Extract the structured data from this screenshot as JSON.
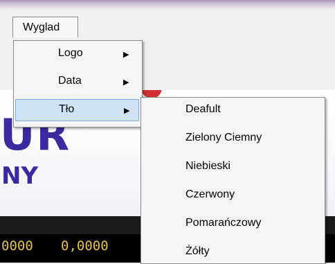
{
  "menubar": {
    "menu_label": "Wyglad"
  },
  "background_app": {
    "logo_text": "UR",
    "logo_sub": "NY",
    "display_values": [
      "0000",
      "0,0000"
    ]
  },
  "wyglad_menu": {
    "items": [
      {
        "label": "Logo",
        "has_submenu": true,
        "arrow_icon": "chevron-right-icon"
      },
      {
        "label": "Data",
        "has_submenu": true,
        "arrow_icon": "chevron-right-icon"
      },
      {
        "label": "Tło",
        "has_submenu": true,
        "arrow_icon": "chevron-right-icon",
        "selected": true
      }
    ]
  },
  "tlo_submenu": {
    "items": [
      "Deafult",
      "Zielony Ciemny",
      "Niebieski",
      "Czerwony",
      "Pomarańczowy",
      "Żółty"
    ]
  },
  "colors": {
    "selection_fill": "#cfe3f7",
    "selection_border": "#7fa9d6",
    "logo_color": "#3a2aa0",
    "display_digits": "#e6c34a"
  }
}
